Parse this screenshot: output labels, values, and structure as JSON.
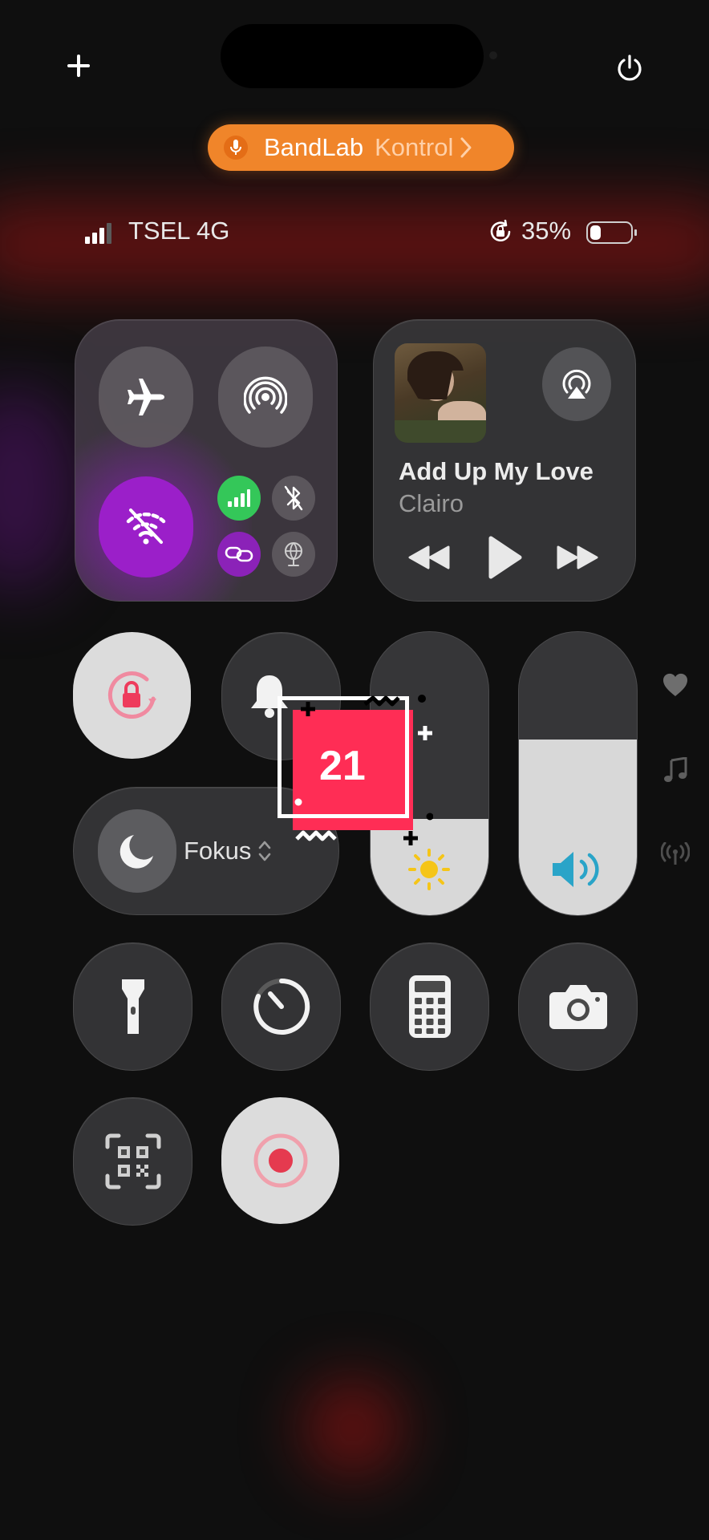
{
  "top": {
    "add_icon": "plus-icon",
    "power_icon": "power-icon"
  },
  "live_activity": {
    "app": "BandLab",
    "action": "Kontrol",
    "accent": "#f0852a"
  },
  "status": {
    "carrier": "TSEL 4G",
    "battery_percent": "35%",
    "battery_level": 0.35
  },
  "connectivity": {
    "airplane": "airplane-icon",
    "airdrop": "airdrop-icon",
    "wifi_off_color": "#9b1fc9",
    "cellular_color": "#34c759"
  },
  "now_playing": {
    "title": "Add Up My Love",
    "artist": "Clairo"
  },
  "focus": {
    "label": "Fokus"
  },
  "sticker": {
    "number": "21",
    "color": "#ff2d55"
  },
  "sliders": {
    "brightness_level": 0.34,
    "volume_level": 0.62
  },
  "side_icons": [
    "heart-icon",
    "music-note-icon",
    "antenna-icon"
  ]
}
